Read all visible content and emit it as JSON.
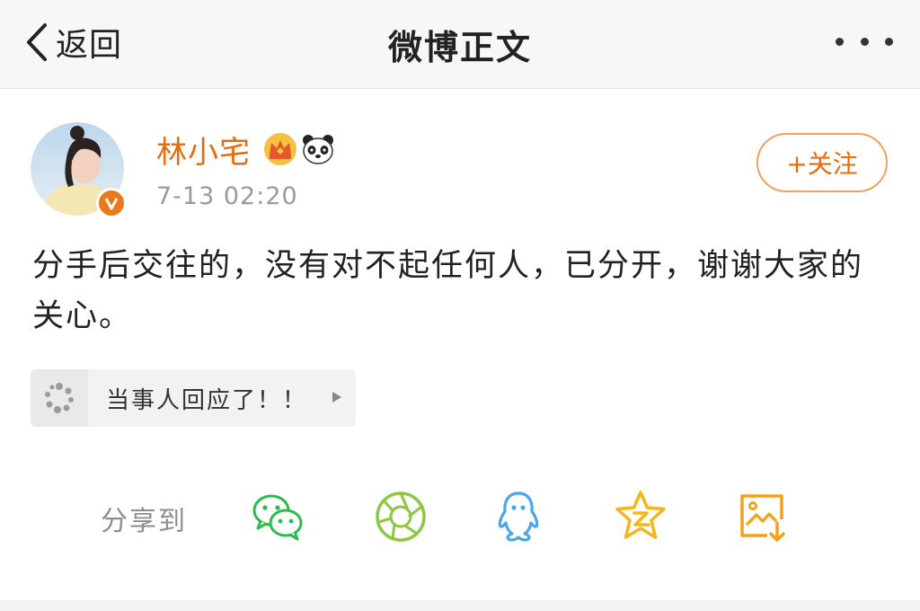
{
  "navbar": {
    "back_label": "返回",
    "title": "微博正文"
  },
  "post": {
    "username": "林小宅",
    "timestamp": "7-13 02:20",
    "follow_label": "+关注",
    "text": "分手后交往的，没有对不起任何人，已分开，谢谢大家的关心。",
    "topic_label": "当事人回应了！！"
  },
  "share": {
    "label": "分享到",
    "targets": [
      "wechat-icon",
      "moments-icon",
      "qq-icon",
      "qzone-icon",
      "save-image-icon"
    ]
  },
  "colors": {
    "accent": "#e86b0c",
    "wechat": "#2dbb4c",
    "moments": "#8ec63f",
    "qq": "#4aa8e8",
    "qzone": "#f4b71a",
    "save": "#f0a21a"
  }
}
